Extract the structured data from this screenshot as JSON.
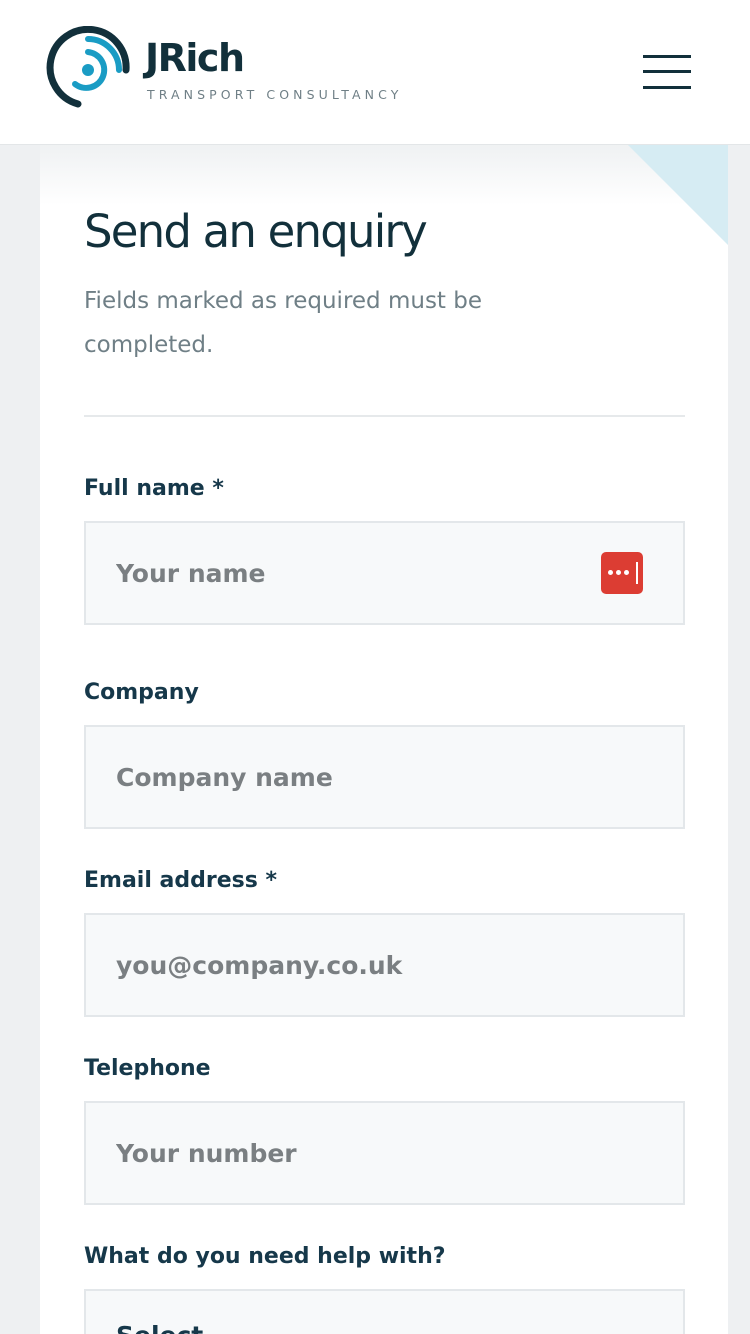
{
  "header": {
    "brand_name": "JRich",
    "brand_tagline": "TRANSPORT CONSULTANCY",
    "logo_icon": "signal-rings-logo",
    "menu_icon": "hamburger-menu-icon",
    "colors": {
      "brand_dark": "#12303b",
      "brand_accent": "#1a9cc4"
    }
  },
  "form": {
    "title": "Send an enquiry",
    "subtitle": "Fields marked as required must be completed.",
    "fields": [
      {
        "label": "Full name *",
        "placeholder": "Your name",
        "value": ""
      },
      {
        "label": "Company",
        "placeholder": "Company name",
        "value": ""
      },
      {
        "label": "Email address *",
        "placeholder": "you@company.co.uk",
        "value": ""
      },
      {
        "label": "Telephone",
        "placeholder": "Your number",
        "value": ""
      }
    ],
    "help_label": "What do you need help with?",
    "help_select_value": "Select...",
    "password_manager_icon": "password-manager-icon",
    "colors": {
      "password_manager": "#dc3d33",
      "corner_accent": "#d6ecf3"
    }
  }
}
